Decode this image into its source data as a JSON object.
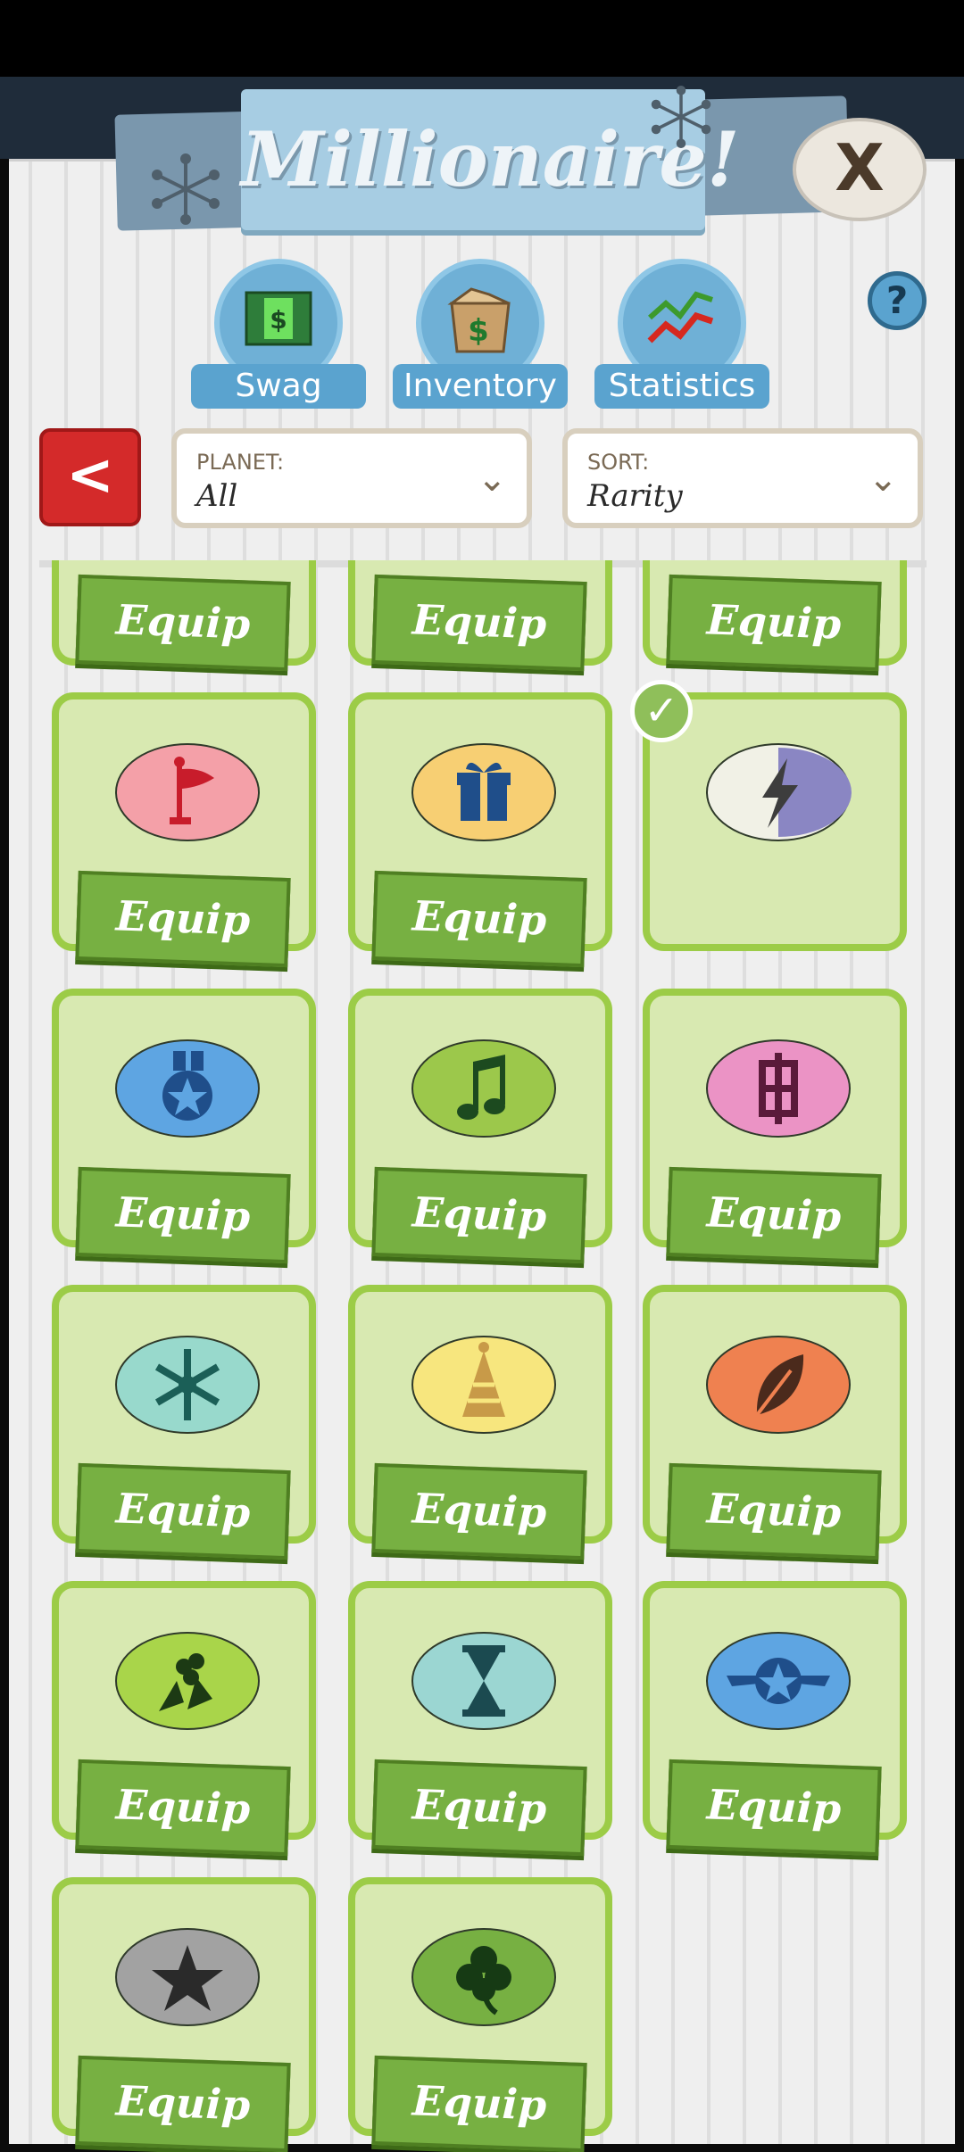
{
  "header": {
    "title": "Millionaire!",
    "close_label": "X"
  },
  "tabs": [
    {
      "label": "Swag",
      "icon": "cash-door-icon"
    },
    {
      "label": "Inventory",
      "icon": "money-box-icon"
    },
    {
      "label": "Statistics",
      "icon": "trend-arrows-icon"
    }
  ],
  "help_label": "?",
  "filters": {
    "back_label": "<",
    "planet": {
      "caption": "PLANET:",
      "value": "All"
    },
    "sort": {
      "caption": "SORT:",
      "value": "Rarity"
    }
  },
  "equip_label": "Equip",
  "items": [
    {
      "icon": "flag-icon",
      "color": "#f4a0a8",
      "equippable": true
    },
    {
      "icon": "gift-icon",
      "color": "#f7cf73",
      "equippable": true
    },
    {
      "icon": "lightning-icon",
      "color": "#f1f1e6",
      "equipped": true
    },
    {
      "icon": "medal-star-icon",
      "color": "#5ea5e2",
      "equippable": true
    },
    {
      "icon": "music-note-icon",
      "color": "#9cc84b",
      "equippable": true
    },
    {
      "icon": "pixel-dollar-icon",
      "color": "#eb93c5",
      "equippable": true
    },
    {
      "icon": "snowflake-icon",
      "color": "#98d9cc",
      "equippable": true
    },
    {
      "icon": "party-hat-icon",
      "color": "#f7e67e",
      "equippable": true
    },
    {
      "icon": "leaf-icon",
      "color": "#ef8150",
      "equippable": true
    },
    {
      "icon": "holly-icon",
      "color": "#a9d54a",
      "equippable": true
    },
    {
      "icon": "hourglass-icon",
      "color": "#9bd6d2",
      "equippable": true
    },
    {
      "icon": "winged-star-icon",
      "color": "#5ea5e2",
      "equippable": true
    },
    {
      "icon": "star-icon",
      "color": "#a2a2a2",
      "equippable": true
    },
    {
      "icon": "clover-icon",
      "color": "#77b042",
      "equippable": true
    }
  ]
}
